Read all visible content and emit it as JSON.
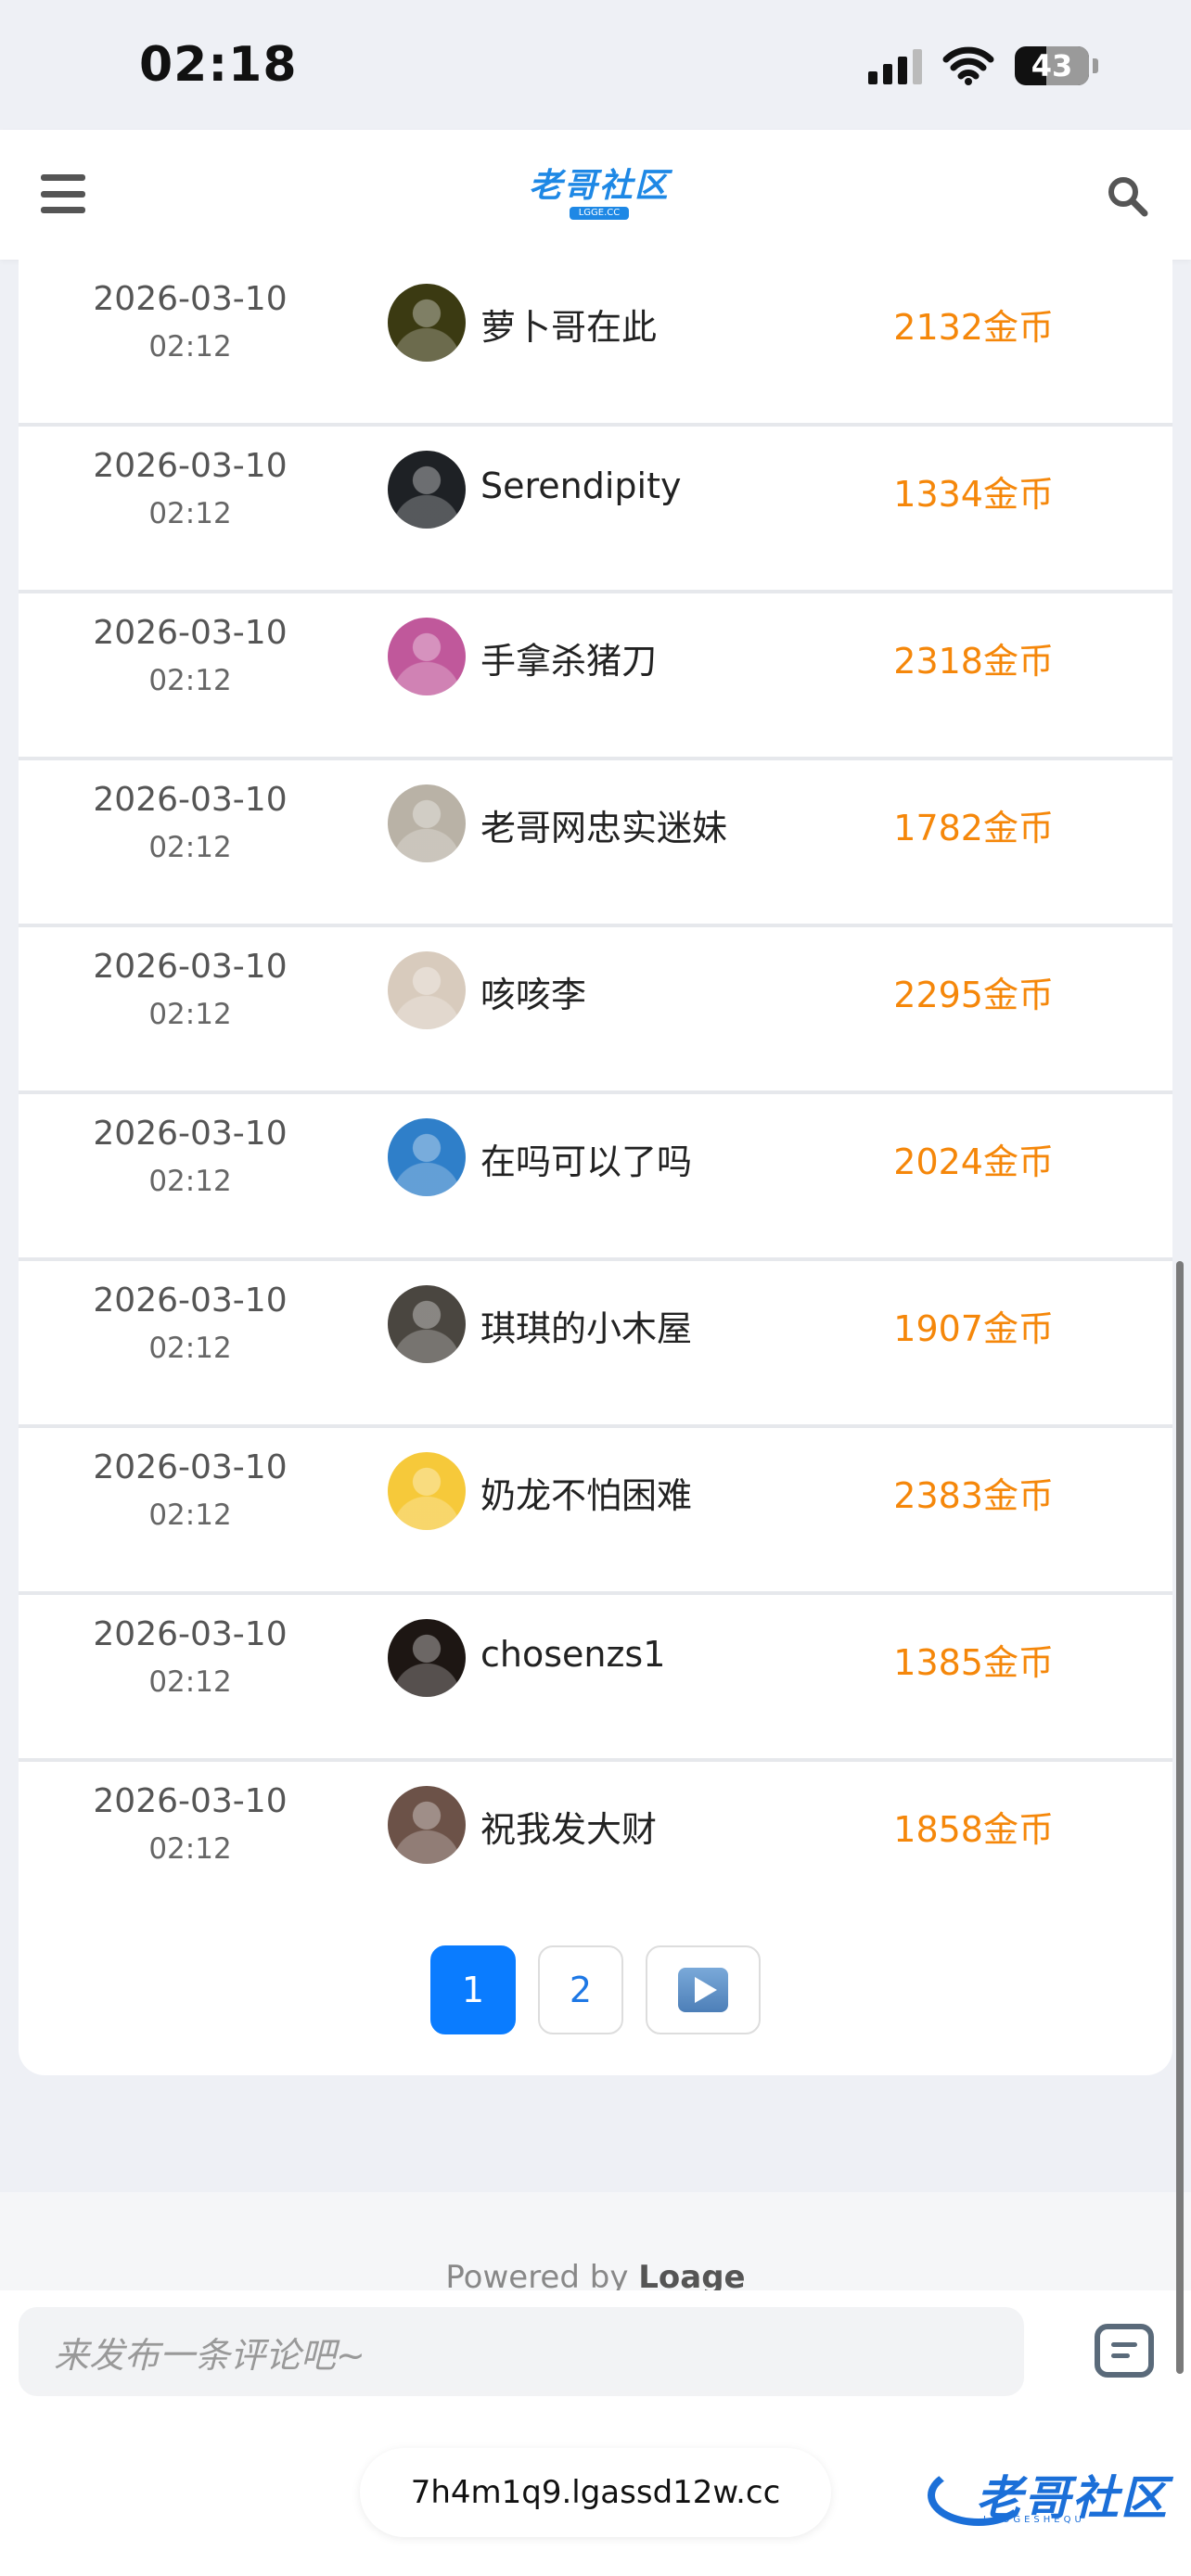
{
  "status_bar": {
    "time": "02:18",
    "battery_level": "43",
    "battery_percent": 43
  },
  "header": {
    "logo_text": "老哥社区",
    "logo_sub": "LGGE.CC",
    "menu_icon": "hamburger-menu-icon",
    "search_icon": "search-icon"
  },
  "records": [
    {
      "date": "2026-03-10",
      "time": "02:12",
      "username": "萝卜哥在此",
      "coins": "2132金币",
      "avatar_color": "#3b3a12"
    },
    {
      "date": "2026-03-10",
      "time": "02:12",
      "username": "Serendipity",
      "coins": "1334金币",
      "avatar_color": "#1e2125"
    },
    {
      "date": "2026-03-10",
      "time": "02:12",
      "username": "手拿杀猪刀",
      "coins": "2318金币",
      "avatar_color": "#c0589b"
    },
    {
      "date": "2026-03-10",
      "time": "02:12",
      "username": "老哥网忠实迷妹",
      "coins": "1782金币",
      "avatar_color": "#b9b2a6"
    },
    {
      "date": "2026-03-10",
      "time": "02:12",
      "username": "咳咳李",
      "coins": "2295金币",
      "avatar_color": "#d8cbbd"
    },
    {
      "date": "2026-03-10",
      "time": "02:12",
      "username": "在吗可以了吗",
      "coins": "2024金币",
      "avatar_color": "#2f7fc9"
    },
    {
      "date": "2026-03-10",
      "time": "02:12",
      "username": "琪琪的小木屋",
      "coins": "1907金币",
      "avatar_color": "#4a4640"
    },
    {
      "date": "2026-03-10",
      "time": "02:12",
      "username": "奶龙不怕困难",
      "coins": "2383金币",
      "avatar_color": "#f6c93a"
    },
    {
      "date": "2026-03-10",
      "time": "02:12",
      "username": "chosenzs1",
      "coins": "1385金币",
      "avatar_color": "#1d1613"
    },
    {
      "date": "2026-03-10",
      "time": "02:12",
      "username": "祝我发大财",
      "coins": "1858金币",
      "avatar_color": "#6c5248"
    }
  ],
  "pagination": {
    "current": "1",
    "page2": "2",
    "next_icon": "play-next-icon"
  },
  "footer": {
    "powered_prefix": "Powered by",
    "powered_brand": "Loage"
  },
  "comment": {
    "placeholder": "来发布一条评论吧~",
    "icon": "comment-icon"
  },
  "url_pill": "7h4m1q9.lgassd12w.cc",
  "watermark": {
    "text": "老哥社区",
    "sub": "LAOGESHEQU"
  },
  "colors": {
    "accent": "#0a7cff",
    "coins": "#f5870a"
  }
}
